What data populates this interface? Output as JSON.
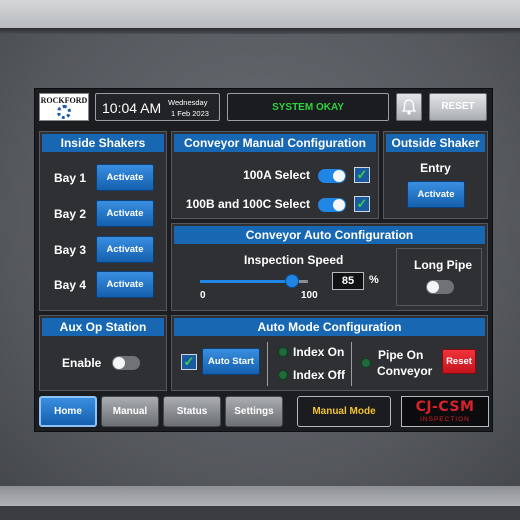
{
  "header": {
    "logo": "ROCKFORD",
    "time": "10:04 AM",
    "weekday": "Wednesday",
    "date": "1 Feb 2023",
    "status": "SYSTEM OKAY",
    "reset_label": "RESET",
    "bell_icon": "bell-icon"
  },
  "inside_shakers": {
    "title": "Inside Shakers",
    "items": [
      {
        "label": "Bay 1",
        "button": "Activate"
      },
      {
        "label": "Bay 2",
        "button": "Activate"
      },
      {
        "label": "Bay 3",
        "button": "Activate"
      },
      {
        "label": "Bay 4",
        "button": "Activate"
      }
    ]
  },
  "conveyor_manual": {
    "title": "Conveyor Manual Configuration",
    "rows": [
      {
        "label": "100A Select",
        "toggle": true,
        "checked": true
      },
      {
        "label": "100B and 100C Select",
        "toggle": true,
        "checked": true
      }
    ]
  },
  "outside_shaker": {
    "title": "Outside Shaker",
    "entry_label": "Entry",
    "button": "Activate"
  },
  "conveyor_auto": {
    "title": "Conveyor Auto Configuration",
    "speed_label": "Inspection Speed",
    "min": "0",
    "max": "100",
    "value": "85",
    "unit": "%",
    "slider_fraction": 0.85,
    "long_pipe_label": "Long Pipe",
    "long_pipe_on": false
  },
  "aux_op": {
    "title": "Aux Op Station",
    "enable_label": "Enable",
    "enabled": false
  },
  "auto_mode": {
    "title": "Auto Mode Configuration",
    "checked": true,
    "auto_start_label": "Auto Start",
    "index_on_label": "Index On",
    "index_off_label": "Index Off",
    "pipe_on_label": "Pipe On",
    "conveyor_label": "Conveyor",
    "reset_label": "Reset"
  },
  "nav": {
    "home": "Home",
    "manual": "Manual",
    "status": "Status",
    "settings": "Settings",
    "mode": "Manual Mode",
    "brand": "CJ-CSM",
    "brand_sub": "INSPECTION"
  },
  "colors": {
    "accent_blue": "#1867b3",
    "status_green": "#2fd23f",
    "mode_yellow": "#f2c230",
    "brand_red": "#d9222a",
    "reset_red": "#e0202a"
  }
}
